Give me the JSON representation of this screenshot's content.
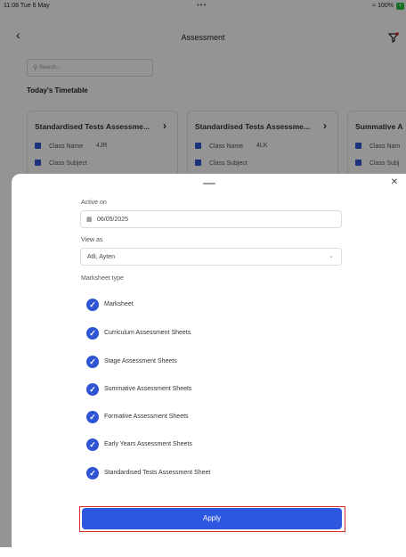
{
  "status_bar": {
    "time": "11:08 Tue 6 May",
    "right": "100%",
    "battery_plus": "+"
  },
  "nav": {
    "title": "Assessment"
  },
  "search": {
    "placeholder": "Search..."
  },
  "section_title": "Today's Timetable",
  "cards": [
    {
      "title": "Standardised Tests Assessme...",
      "class_name_label": "Class Name",
      "class_name_value": "4JR",
      "class_subject_label": "Class Subject"
    },
    {
      "title": "Standardised Tests Assessme...",
      "class_name_label": "Class Name",
      "class_name_value": "4LK",
      "class_subject_label": "Class Subject"
    },
    {
      "title": "Summative A",
      "class_name_label": "Class Nam",
      "class_name_value": "",
      "class_subject_label": "Class Subj"
    }
  ],
  "sheet": {
    "active_on_label": "Active on",
    "active_on_value": "06/05/2025",
    "view_as_label": "View as",
    "view_as_value": "Atli, Ayten",
    "marksheet_type_label": "Marksheet type",
    "options": [
      {
        "label": "Marksheet",
        "checked": true
      },
      {
        "label": "Curriculum Assessment Sheets",
        "checked": true
      },
      {
        "label": "Stage Assessment Sheets",
        "checked": true
      },
      {
        "label": "Summative Assessment Sheets",
        "checked": true
      },
      {
        "label": "Formative Assessment Sheets",
        "checked": true
      },
      {
        "label": "Early Years Assessment Sheets",
        "checked": true
      },
      {
        "label": "Standardised Tests Assessment Sheet",
        "checked": true
      }
    ],
    "apply_label": "Apply"
  },
  "colors": {
    "accent": "#2d57df",
    "highlight_border": "#d52828",
    "icon_blue": "#2f55d4",
    "battery_green": "#27c23a"
  },
  "icons": [
    "back-chevron-icon",
    "filter-icon",
    "search-icon",
    "calendar-icon",
    "dropdown-chevron-icon",
    "close-icon",
    "check-icon"
  ]
}
